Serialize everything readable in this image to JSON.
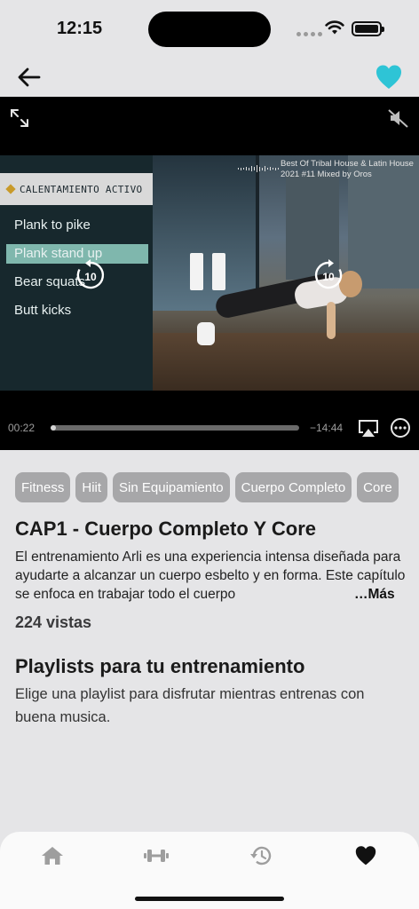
{
  "status_bar": {
    "time": "12:15"
  },
  "player": {
    "category_title": "CALENTAMIENTO ACTIVO",
    "exercises": [
      {
        "label": "Plank to pike",
        "active": false
      },
      {
        "label": "Plank stand up",
        "active": true
      },
      {
        "label": "Bear squats",
        "active": false
      },
      {
        "label": "Butt kicks",
        "active": false
      }
    ],
    "track_title_line1": "Best Of Tribal House & Latin House",
    "track_title_line2": "2021 #11  Mixed by Oros",
    "skip_back_seconds": "10",
    "skip_forward_seconds": "10",
    "elapsed": "00:22",
    "remaining": "−14:44",
    "progress_fraction": 0.02
  },
  "tags": [
    "Fitness",
    "Hiit",
    "Sin Equipamiento",
    "Cuerpo Completo",
    "Core"
  ],
  "episode": {
    "title": "CAP1 - Cuerpo Completo Y Core",
    "description": "El entrenamiento Arli es una experiencia intensa diseñada para ayudarte a alcanzar un cuerpo esbelto y en forma. Este capítulo se enfoca en trabajar todo el cuerpo",
    "more_label": "…Más",
    "views": "224 vistas"
  },
  "playlists": {
    "title": "Playlists para tu entrenamiento",
    "subtitle": "Elige una playlist para disfrutar mientras entrenas con buena musica."
  },
  "tabbar": {
    "items": [
      "home-icon",
      "dumbbell-icon",
      "history-icon",
      "heart-icon"
    ],
    "active_index": 3
  },
  "colors": {
    "accent": "#2ec4d6",
    "tag_bg": "#a7a7a9",
    "active_exercise": "#7fb7ad"
  }
}
